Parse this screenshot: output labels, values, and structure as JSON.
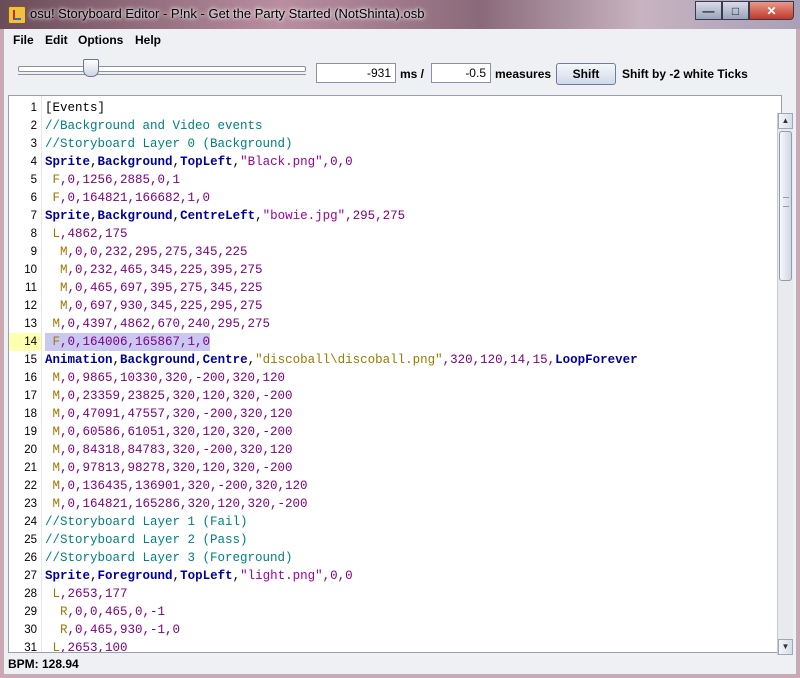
{
  "window": {
    "title": "osu! Storyboard Editor - P!nk - Get the Party Started (NotShinta).osb",
    "min_glyph": "—",
    "max_glyph": "□",
    "close_glyph": "✕"
  },
  "menu": {
    "file": "File",
    "edit": "Edit",
    "options": "Options",
    "help": "Help"
  },
  "toolbar": {
    "ms_value": "-931",
    "ms_label": "ms /",
    "measures_value": "-0.5",
    "measures_label": "measures",
    "shift_button": "Shift",
    "shift_info": "Shift by -2 white Ticks"
  },
  "status": {
    "bpm": "BPM: 128.94"
  },
  "colors": {
    "comment": "#008080",
    "keyword": "#0000a0",
    "string": "#a000a0",
    "command": "#a07800",
    "current_line": "#ffffb0",
    "selection": "#c8c8f0"
  },
  "editor": {
    "current_line": 14,
    "lines": [
      {
        "n": "1",
        "tokens": [
          [
            "sec",
            "[Events]"
          ]
        ]
      },
      {
        "n": "2",
        "tokens": [
          [
            "cmt",
            "//Background and Video events"
          ]
        ]
      },
      {
        "n": "3",
        "tokens": [
          [
            "cmt",
            "//Storyboard Layer 0 (Background)"
          ]
        ]
      },
      {
        "n": "4",
        "tokens": [
          [
            "kw",
            "Sprite"
          ],
          [
            "plain",
            ","
          ],
          [
            "kw",
            "Background"
          ],
          [
            "plain",
            ","
          ],
          [
            "kw",
            "TopLeft"
          ],
          [
            "plain",
            ","
          ],
          [
            "str",
            "\"Black.png\""
          ],
          [
            "num",
            ",0,0"
          ]
        ]
      },
      {
        "n": "5",
        "tokens": [
          [
            "cmd",
            " F"
          ],
          [
            "num",
            ",0,1256,2885,0,1"
          ]
        ]
      },
      {
        "n": "6",
        "tokens": [
          [
            "cmd",
            " F"
          ],
          [
            "num",
            ",0,164821,166682,1,0"
          ]
        ]
      },
      {
        "n": "7",
        "tokens": [
          [
            "kw",
            "Sprite"
          ],
          [
            "plain",
            ","
          ],
          [
            "kw",
            "Background"
          ],
          [
            "plain",
            ","
          ],
          [
            "kw",
            "CentreLeft"
          ],
          [
            "plain",
            ","
          ],
          [
            "str",
            "\"bowie.jpg\""
          ],
          [
            "num",
            ",295,275"
          ]
        ]
      },
      {
        "n": "8",
        "tokens": [
          [
            "cmd",
            " L"
          ],
          [
            "num",
            ",4862,175"
          ]
        ]
      },
      {
        "n": "9",
        "tokens": [
          [
            "cmd",
            "  M"
          ],
          [
            "num",
            ",0,0,232,295,275,345,225"
          ]
        ]
      },
      {
        "n": "10",
        "tokens": [
          [
            "cmd",
            "  M"
          ],
          [
            "num",
            ",0,232,465,345,225,395,275"
          ]
        ]
      },
      {
        "n": "11",
        "tokens": [
          [
            "cmd",
            "  M"
          ],
          [
            "num",
            ",0,465,697,395,275,345,225"
          ]
        ]
      },
      {
        "n": "12",
        "tokens": [
          [
            "cmd",
            "  M"
          ],
          [
            "num",
            ",0,697,930,345,225,295,275"
          ]
        ]
      },
      {
        "n": "13",
        "tokens": [
          [
            "cmd",
            " M"
          ],
          [
            "num",
            ",0,4397,4862,670,240,295,275"
          ]
        ]
      },
      {
        "n": "14",
        "tokens": [
          [
            "cmd",
            " F"
          ],
          [
            "num",
            ",0,164006,165867,1,0"
          ]
        ]
      },
      {
        "n": "15",
        "tokens": [
          [
            "kw",
            "Animation"
          ],
          [
            "plain",
            ","
          ],
          [
            "kw",
            "Background"
          ],
          [
            "plain",
            ","
          ],
          [
            "kw",
            "Centre"
          ],
          [
            "plain",
            ","
          ],
          [
            "str2",
            "\"discoball\\discoball.png\""
          ],
          [
            "num",
            ",320,120,14,15,"
          ],
          [
            "kw",
            "LoopForever"
          ]
        ]
      },
      {
        "n": "16",
        "tokens": [
          [
            "cmd",
            " M"
          ],
          [
            "num",
            ",0,9865,10330,320,-200,320,120"
          ]
        ]
      },
      {
        "n": "17",
        "tokens": [
          [
            "cmd",
            " M"
          ],
          [
            "num",
            ",0,23359,23825,320,120,320,-200"
          ]
        ]
      },
      {
        "n": "18",
        "tokens": [
          [
            "cmd",
            " M"
          ],
          [
            "num",
            ",0,47091,47557,320,-200,320,120"
          ]
        ]
      },
      {
        "n": "19",
        "tokens": [
          [
            "cmd",
            " M"
          ],
          [
            "num",
            ",0,60586,61051,320,120,320,-200"
          ]
        ]
      },
      {
        "n": "20",
        "tokens": [
          [
            "cmd",
            " M"
          ],
          [
            "num",
            ",0,84318,84783,320,-200,320,120"
          ]
        ]
      },
      {
        "n": "21",
        "tokens": [
          [
            "cmd",
            " M"
          ],
          [
            "num",
            ",0,97813,98278,320,120,320,-200"
          ]
        ]
      },
      {
        "n": "22",
        "tokens": [
          [
            "cmd",
            " M"
          ],
          [
            "num",
            ",0,136435,136901,320,-200,320,120"
          ]
        ]
      },
      {
        "n": "23",
        "tokens": [
          [
            "cmd",
            " M"
          ],
          [
            "num",
            ",0,164821,165286,320,120,320,-200"
          ]
        ]
      },
      {
        "n": "24",
        "tokens": [
          [
            "cmt",
            "//Storyboard Layer 1 (Fail)"
          ]
        ]
      },
      {
        "n": "25",
        "tokens": [
          [
            "cmt",
            "//Storyboard Layer 2 (Pass)"
          ]
        ]
      },
      {
        "n": "26",
        "tokens": [
          [
            "cmt",
            "//Storyboard Layer 3 (Foreground)"
          ]
        ]
      },
      {
        "n": "27",
        "tokens": [
          [
            "kw",
            "Sprite"
          ],
          [
            "plain",
            ","
          ],
          [
            "kw",
            "Foreground"
          ],
          [
            "plain",
            ","
          ],
          [
            "kw",
            "TopLeft"
          ],
          [
            "plain",
            ","
          ],
          [
            "str",
            "\"light.png\""
          ],
          [
            "num",
            ",0,0"
          ]
        ]
      },
      {
        "n": "28",
        "tokens": [
          [
            "cmd",
            " L"
          ],
          [
            "num",
            ",2653,177"
          ]
        ]
      },
      {
        "n": "29",
        "tokens": [
          [
            "cmd",
            "  R"
          ],
          [
            "num",
            ",0,0,465,0,-1"
          ]
        ]
      },
      {
        "n": "30",
        "tokens": [
          [
            "cmd",
            "  R"
          ],
          [
            "num",
            ",0,465,930,-1,0"
          ]
        ]
      },
      {
        "n": "31",
        "tokens": [
          [
            "cmd",
            " L"
          ],
          [
            "num",
            ",2653,100"
          ]
        ]
      }
    ]
  }
}
